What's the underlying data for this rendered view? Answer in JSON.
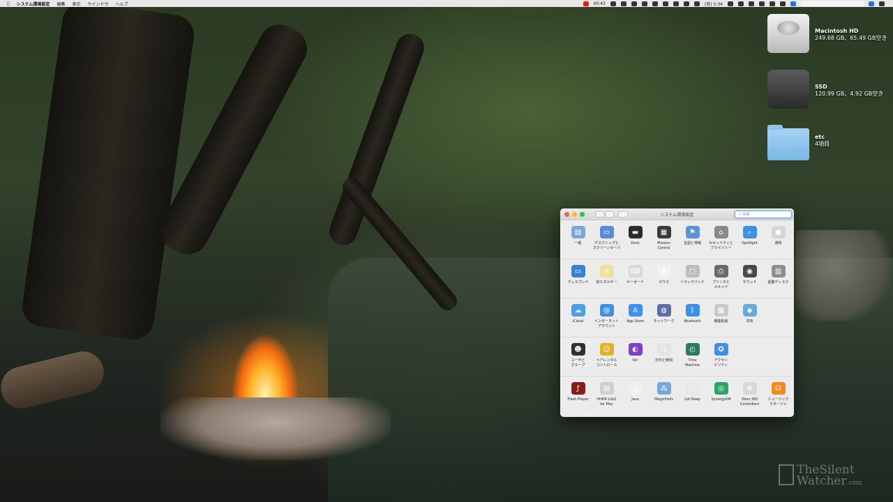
{
  "menubar": {
    "app": "システム環境設定",
    "items": [
      "編集",
      "表示",
      "ウインドウ",
      "ヘルプ"
    ],
    "time_small": "00:43",
    "clock": "(月) 5:34"
  },
  "desktop": {
    "icons": [
      {
        "name": "Macintosh HD",
        "sub": "249.68 GB、65.49 GB空き"
      },
      {
        "name": "SSD",
        "sub": "120.99 GB、4.92 GB空き"
      },
      {
        "name": "etc",
        "sub": "4項目"
      }
    ]
  },
  "window": {
    "title": "システム環境設定",
    "search_placeholder": "検索",
    "rows": [
      [
        {
          "label": "一般",
          "icon": "general-icon",
          "color": "#7aa6d9"
        },
        {
          "label": "デスクトップと\nスクリーンセーバ",
          "icon": "desktop-icon",
          "color": "#5b8ad8"
        },
        {
          "label": "Dock",
          "icon": "dock-icon",
          "color": "#2b2b2b"
        },
        {
          "label": "Mission\nControl",
          "icon": "mission-control-icon",
          "color": "#3a3a3a"
        },
        {
          "label": "言語と地域",
          "icon": "flag-icon",
          "color": "#5a96d6"
        },
        {
          "label": "セキュリティと\nプライバシー",
          "icon": "house-lock-icon",
          "color": "#8a8a8a"
        },
        {
          "label": "Spotlight",
          "icon": "spotlight-icon",
          "color": "#3f8fe5"
        },
        {
          "label": "通知",
          "icon": "notification-icon",
          "color": "#d6d6d6"
        }
      ],
      [
        {
          "label": "ディスプレイ",
          "icon": "display-icon",
          "color": "#3a7fd6"
        },
        {
          "label": "省エネルギー",
          "icon": "bulb-icon",
          "color": "#e9e39c"
        },
        {
          "label": "キーボード",
          "icon": "keyboard-icon",
          "color": "#d9d9d9"
        },
        {
          "label": "マウス",
          "icon": "mouse-icon",
          "color": "#f2f2f2"
        },
        {
          "label": "トラックパッド",
          "icon": "trackpad-icon",
          "color": "#bdbdbd"
        },
        {
          "label": "プリンタと\nスキャナ",
          "icon": "printer-icon",
          "color": "#6a6a6a"
        },
        {
          "label": "サウンド",
          "icon": "speaker-icon",
          "color": "#4a4a4a"
        },
        {
          "label": "起動ディスク",
          "icon": "disk-icon",
          "color": "#8d8d8d"
        }
      ],
      [
        {
          "label": "iCloud",
          "icon": "cloud-icon",
          "color": "#4a9fe6"
        },
        {
          "label": "インターネット\nアカウント",
          "icon": "at-icon",
          "color": "#3f8fe5"
        },
        {
          "label": "App Store",
          "icon": "app-store-icon",
          "color": "#3d8ff0"
        },
        {
          "label": "ネットワーク",
          "icon": "globe-icon",
          "color": "#5b6fa8"
        },
        {
          "label": "Bluetooth",
          "icon": "bluetooth-icon",
          "color": "#3f8fe5"
        },
        {
          "label": "機能拡張",
          "icon": "puzzle-icon",
          "color": "#c9c9c9"
        },
        {
          "label": "共有",
          "icon": "sharing-icon",
          "color": "#6aa9dc"
        }
      ],
      [
        {
          "label": "ユーザと\nグループ",
          "icon": "users-icon",
          "color": "#2f2f2f"
        },
        {
          "label": "ペアレンタル\nコントロール",
          "icon": "parental-icon",
          "color": "#e0b325"
        },
        {
          "label": "Siri",
          "icon": "siri-icon",
          "color": "#7b3fc9"
        },
        {
          "label": "日付と時刻",
          "icon": "clock-icon",
          "color": "#e4e4e4"
        },
        {
          "label": "Time\nMachine",
          "icon": "time-machine-icon",
          "color": "#2f7a5a"
        },
        {
          "label": "アクセシ\nビリティ",
          "icon": "accessibility-icon",
          "color": "#3f8fe5"
        }
      ],
      [
        {
          "label": "Flash Player",
          "icon": "flash-icon",
          "color": "#8b1a1a"
        },
        {
          "label": "HHKB Lite2\nfor Mac",
          "icon": "hhkb-icon",
          "color": "#cfcfcf"
        },
        {
          "label": "Java",
          "icon": "java-icon",
          "color": "#f0f0f0"
        },
        {
          "label": "MagicPrefs",
          "icon": "magicprefs-icon",
          "color": "#7aa6d9"
        },
        {
          "label": "Lid Sleep",
          "icon": "lid-sleep-icon",
          "color": "#e8e8e8"
        },
        {
          "label": "SynergyKM",
          "icon": "synergy-icon",
          "color": "#2ea56a"
        },
        {
          "label": "Xbox 360\nControllers",
          "icon": "xbox-controller-icon",
          "color": "#d8d8d8"
        },
        {
          "label": "ミュージック\nマネージャ",
          "icon": "headphones-icon",
          "color": "#f08a1a"
        }
      ]
    ]
  },
  "watermark": {
    "line1": "TheSilent",
    "line2": "Watcher",
    "suffix": ".com"
  }
}
